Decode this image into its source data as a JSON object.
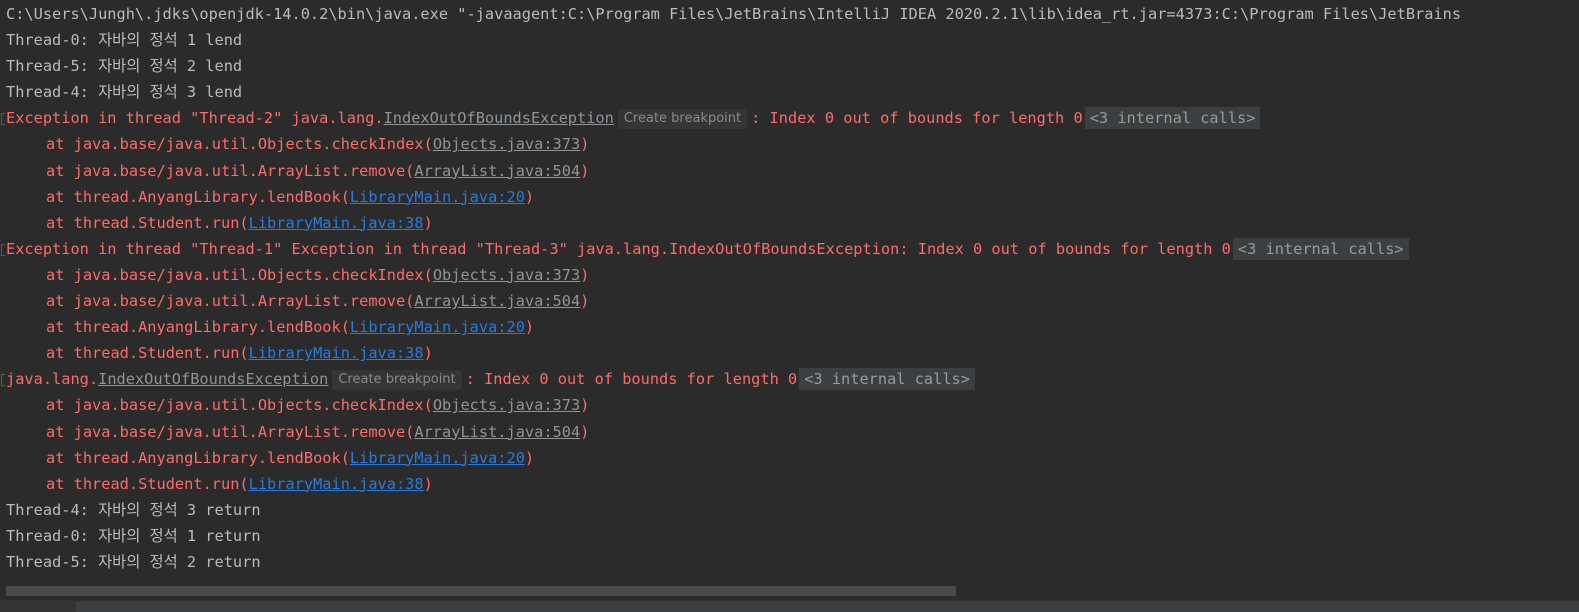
{
  "console": {
    "command_line": "C:\\Users\\Jungh\\.jdks\\openjdk-14.0.2\\bin\\java.exe \"-javaagent:C:\\Program Files\\JetBrains\\IntelliJ IDEA 2020.2.1\\lib\\idea_rt.jar=4373:C:\\Program Files\\JetBrains",
    "create_breakpoint_label": "Create breakpoint",
    "internal_calls_label": "<3 internal calls>",
    "lend_lines": [
      "Thread-0: 자바의 정석 1 lend",
      "Thread-5: 자바의 정석 2 lend",
      "Thread-4: 자바의 정석 3 lend"
    ],
    "exception1": {
      "prefix": "Exception in thread \"Thread-2\" java.lang.",
      "class_link": "IndexOutOfBoundsException",
      "message": ": Index 0 out of bounds for length 0"
    },
    "exception2": {
      "text": "Exception in thread \"Thread-1\" Exception in thread \"Thread-3\" java.lang.IndexOutOfBoundsException: Index 0 out of bounds for length 0"
    },
    "exception3": {
      "prefix": "java.lang.",
      "class_link": "IndexOutOfBoundsException",
      "message": ": Index 0 out of bounds for length 0"
    },
    "frames": {
      "f1_text": "at java.base/java.util.Objects.checkIndex(",
      "f1_link": "Objects.java:373",
      "f2_text": "at java.base/java.util.ArrayList.remove(",
      "f2_link": "ArrayList.java:504",
      "f3_text": "at thread.AnyangLibrary.lendBook(",
      "f3_link": "LibraryMain.java:20",
      "f4_text": "at thread.Student.run(",
      "f4_link": "LibraryMain.java:38",
      "close_paren": ")"
    },
    "return_lines": [
      "Thread-4: 자바의 정석 3 return",
      "Thread-0: 자바의 정석 1 return",
      "Thread-5: 자바의 정석 2 return"
    ]
  }
}
